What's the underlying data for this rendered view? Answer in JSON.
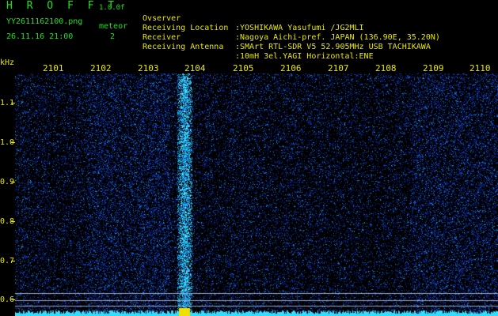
{
  "header": {
    "app_title": "H R O F F T",
    "version": "1.0.0f",
    "filename": "YY2611162100.png",
    "datetime": "26.11.16 21:00",
    "counter_label": "meteor",
    "counter_value": "2"
  },
  "meta": [
    {
      "key": "Ovserver",
      "value": ":YOSHIKAWA Yasufumi /JG2MLI"
    },
    {
      "key": "Receiving Location",
      "value": ":Nagoya Aichi-pref. JAPAN (136.90E, 35.20N)"
    },
    {
      "key": "Receiver",
      "value": ":SMArt RTL-SDR V5 52.905MHz USB TACHIKAWA"
    },
    {
      "key": "Receiving Antenna",
      "value": ":10mH 3el.YAGI Horizontal:ENE"
    }
  ],
  "axis": {
    "y_unit": "kHz",
    "x_labels": [
      "2101",
      "2102",
      "2103",
      "2104",
      "2105",
      "2106",
      "2107",
      "2108",
      "2109",
      "2110"
    ],
    "y_labels": [
      "1.1",
      "1.0",
      "0.9",
      "0.8",
      "0.7",
      "0.6"
    ]
  },
  "colors": {
    "background": "#000000",
    "header_green": "#19e619",
    "header_yellow": "#e8e800",
    "noise_blue": "#1a2fd0",
    "signal_cyan": "#33ddff",
    "marker_yellow": "#f0e000"
  }
}
